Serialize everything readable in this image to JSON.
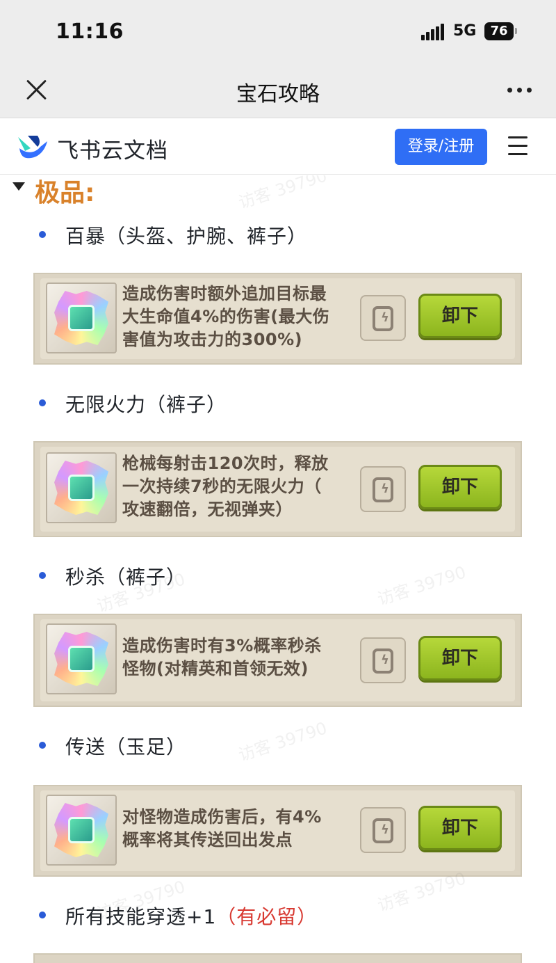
{
  "status_bar": {
    "time": "11:16",
    "network": "5G",
    "battery": "76"
  },
  "nav": {
    "title": "宝石攻略"
  },
  "header": {
    "brand": "飞书云文档",
    "login_label": "登录/注册",
    "accent_color": "#2f6ef5"
  },
  "content": {
    "heading": "极品:",
    "watermark": "访客 39790",
    "items": [
      {
        "title": "百暴（头盔、护腕、裤子）",
        "desc_lines": [
          "造成伤害时额外追加目标最",
          "大生命值4%的伤害(最大伤",
          "害值为攻击力的300%)"
        ],
        "button": "卸下"
      },
      {
        "title": "无限火力（裤子）",
        "desc_lines": [
          "枪械每射击120次时，释放",
          "一次持续7秒的无限火力（",
          "攻速翻倍，无视弹夹）"
        ],
        "button": "卸下"
      },
      {
        "title": "秒杀（裤子）",
        "desc_lines": [
          "造成伤害时有3%概率秒杀",
          "怪物(对精英和首领无效)"
        ],
        "button": "卸下"
      },
      {
        "title": "传送（玉足）",
        "desc_lines": [
          "对怪物造成伤害后，有4%",
          "概率将其传送回出发点"
        ],
        "button": "卸下"
      },
      {
        "title": "所有技能穿透+1",
        "highlight": "（有必留）"
      }
    ]
  }
}
